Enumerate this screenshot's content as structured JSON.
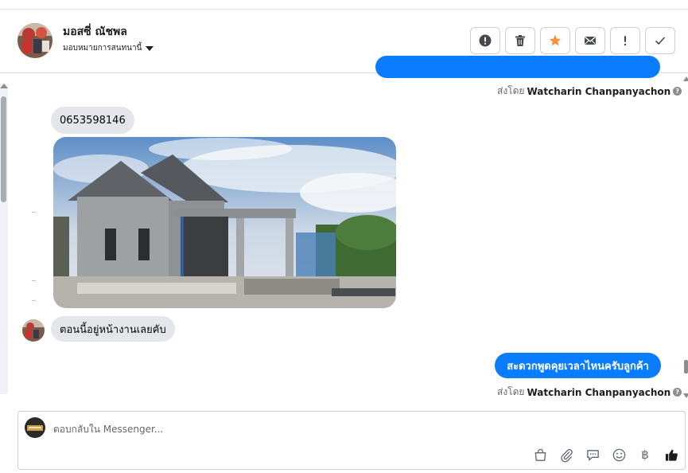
{
  "header": {
    "contact_name": "มอสซี่ ณัชพล",
    "assign_label": "มอบหมายการสนทนานี้",
    "actions": [
      {
        "name": "mark-spam-button",
        "icon": "alert-circle-icon"
      },
      {
        "name": "delete-button",
        "icon": "trash-icon"
      },
      {
        "name": "star-button",
        "icon": "star-icon"
      },
      {
        "name": "mark-unread-button",
        "icon": "envelope-icon"
      },
      {
        "name": "follow-up-button",
        "icon": "exclamation-icon"
      },
      {
        "name": "mark-done-button",
        "icon": "check-icon"
      }
    ]
  },
  "messages": {
    "sent_by_prefix": "ส่งโดย",
    "sender_name": "Watcharin Chanpanyachon",
    "phone_message": "0653598146",
    "photo_alt": "บ้านกำลังก่อสร้าง",
    "incoming_text": "ตอนนี้อยู่หน้างานเลยคับ",
    "outgoing_text": "สะดวกพูดคุยเวลาไหนครับลูกค้า"
  },
  "composer": {
    "placeholder": "ตอบกลับใน Messenger...",
    "tools": [
      "bag-icon",
      "paperclip-icon",
      "saved-reply-icon",
      "emoji-icon",
      "baht-icon",
      "thumbs-up-icon"
    ],
    "baht_symbol": "฿"
  },
  "colors": {
    "accent": "#0a7cff",
    "star": "#f7923a"
  }
}
